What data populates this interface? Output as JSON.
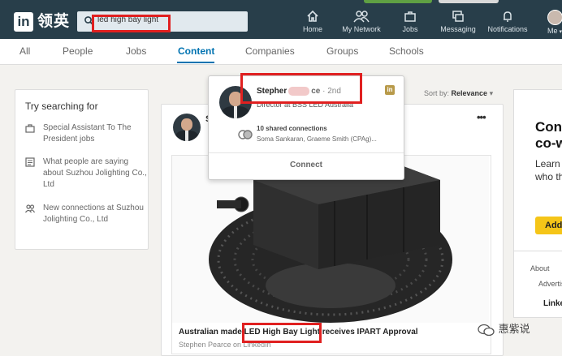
{
  "header": {
    "logo_in": "in",
    "logo_text": "领英",
    "search_value": "led high bay light",
    "nav": [
      {
        "label": "Home",
        "icon": "home-icon"
      },
      {
        "label": "My Network",
        "icon": "network-icon"
      },
      {
        "label": "Jobs",
        "icon": "briefcase-icon"
      },
      {
        "label": "Messaging",
        "icon": "messaging-icon"
      },
      {
        "label": "Notifications",
        "icon": "bell-icon"
      },
      {
        "label": "Me",
        "icon": "avatar-icon"
      }
    ]
  },
  "tabs": [
    "All",
    "People",
    "Jobs",
    "Content",
    "Companies",
    "Groups",
    "Schools"
  ],
  "active_tab": "Content",
  "sidebar": {
    "title": "Try searching for",
    "items": [
      {
        "text": "Special Assistant To The President jobs",
        "icon": "briefcase-icon"
      },
      {
        "text": "What people are saying about Suzhou Jolighting Co., Ltd",
        "icon": "document-icon"
      },
      {
        "text": "New connections at Suzhou Jolighting Co., Ltd",
        "icon": "people-icon"
      }
    ]
  },
  "sort": {
    "prefix": "Sort by:",
    "value": "Relevance"
  },
  "popup": {
    "name": "Stepher",
    "name_tail": "ce",
    "degree": "· 2nd",
    "headline": "Director at BSS LED Australia",
    "shared": "10 shared connections",
    "shared_names": "Soma Sankaran, Graeme Smith (CPAg)...",
    "connect_label": "Connect",
    "linkedin_badge": "in"
  },
  "post": {
    "author_initial": "S",
    "more": "•••",
    "title_pre": "Australian made",
    "title_highlight": "LED High Bay Light",
    "title_post": "receives IPART Approval",
    "byline": "Stephen Pearce on LinkedIn"
  },
  "right_card": {
    "head1": "Con",
    "head2": "co-w",
    "sub1": "Learn",
    "sub2": "who th",
    "button": "Add",
    "link_about": "About",
    "link_advertise": "Advertis",
    "brand": "Linke"
  },
  "watermark": "惠紫说",
  "colors": {
    "topbar": "#283e4a",
    "accent": "#0073b1",
    "highlight": "#e02020",
    "button_yellow": "#f5c518"
  }
}
